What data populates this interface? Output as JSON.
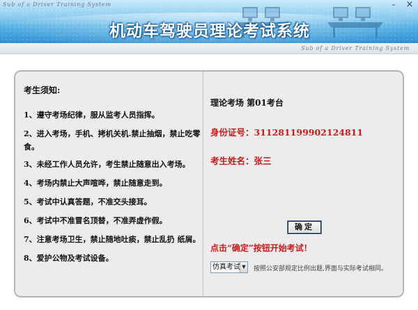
{
  "header": {
    "subtitle_top": "Sub of a Driver Training System",
    "title": "机动车驾驶员理论考试系统",
    "minimize_glyph": "–",
    "close_glyph": "×",
    "strip_text": "Sub of a Driver Training System"
  },
  "notice": {
    "title": "考生须知:",
    "rules": [
      "1、遵守考场纪律，服从监考人员指挥。",
      "2、进入考场，手机、拷机关机.禁止抽烟，禁止吃零食。",
      "3、未经工作人员允许，考生禁止随意出入考场。",
      "4、考场内禁止大声喧哗，禁止随意走到。",
      "5、考试中认真答题，不准交头接耳。",
      "6、考试中不准冒名顶替，不准弄虚作假。",
      "7、注意考场卫生，禁止随地吐痰，禁止乱扔 纸屑。",
      "8、爱护公物及考试设备。"
    ]
  },
  "exam_info": {
    "site": "理论考场  第01考台",
    "id_line": "身份证号：311281199902124811",
    "name_line": "考生姓名：张三"
  },
  "actions": {
    "confirm_label": "确定",
    "confirm_hint": "点击“确定”按钮开始考试！",
    "mode_selected": "仿真考试",
    "mode_description": "按照公安部规定比例出题,界面与实际考试相同。"
  },
  "icons": {
    "dropdown": "chevron-down-icon"
  },
  "colors": {
    "accent_red": "#cc1a1a",
    "banner_blue": "#2f91d4"
  }
}
